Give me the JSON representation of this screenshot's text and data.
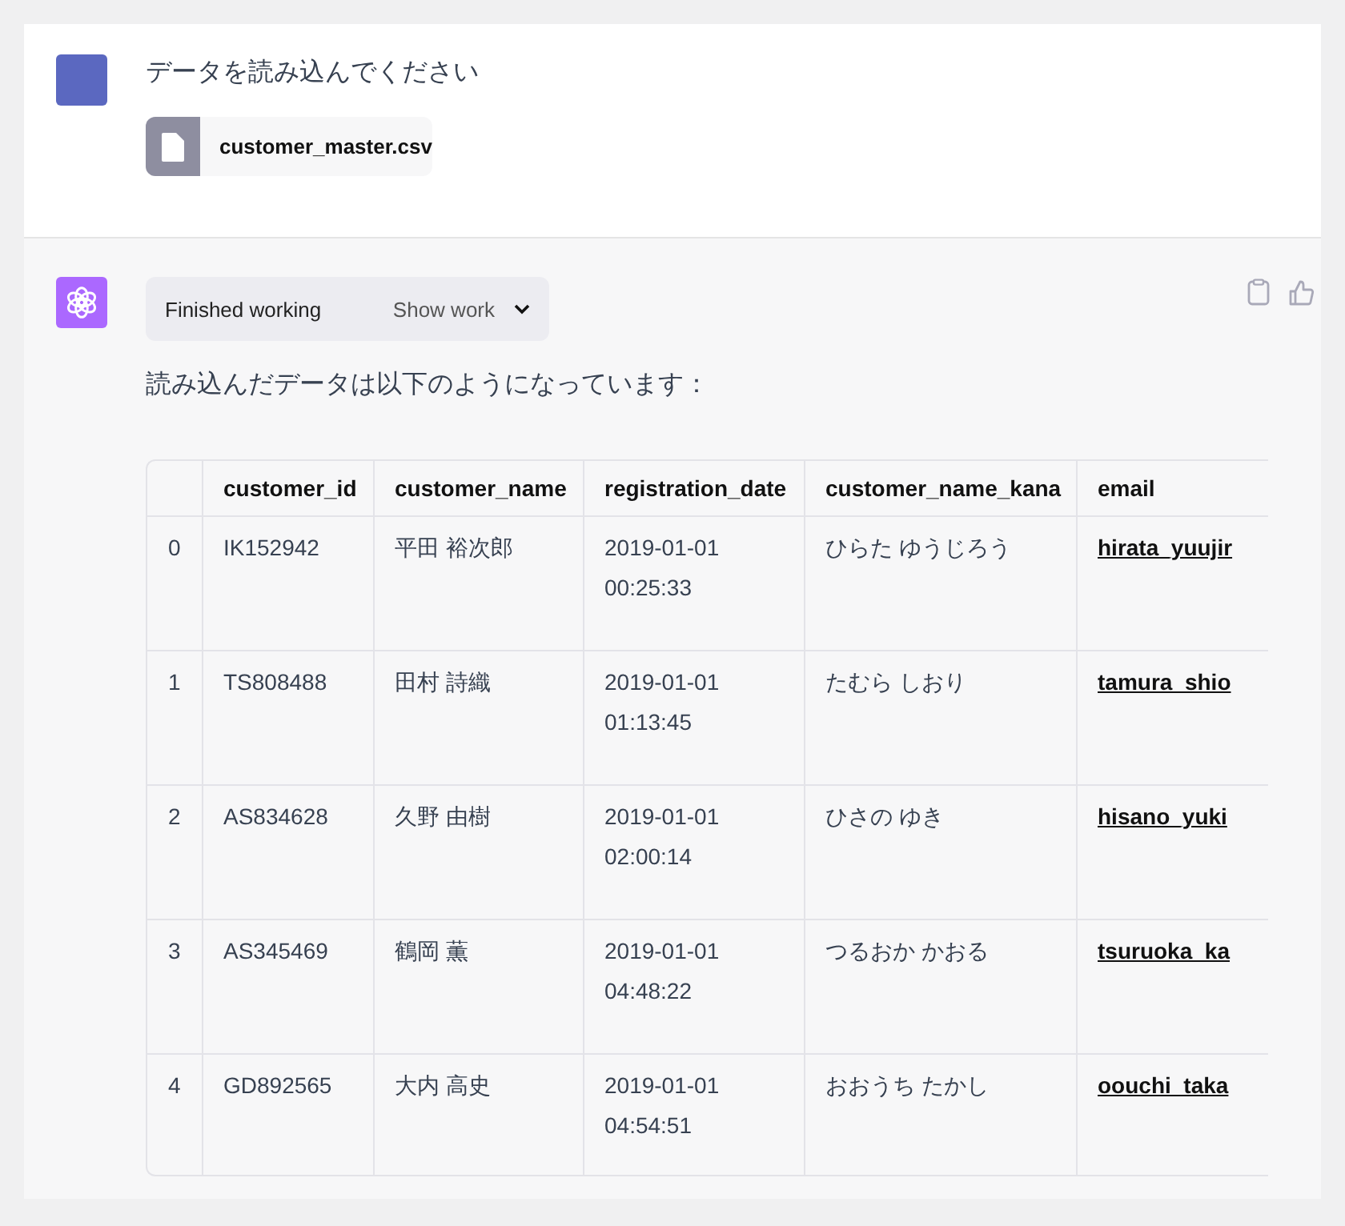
{
  "user_message": {
    "text": "データを読み込んでください",
    "attachment": {
      "filename": "customer_master.csv"
    }
  },
  "assistant_message": {
    "work_status": {
      "label": "Finished working",
      "toggle": "Show work",
      "expanded": false
    },
    "text": "読み込んだデータは以下のようになっています：",
    "table": {
      "columns": [
        "",
        "customer_id",
        "customer_name",
        "registration_date",
        "customer_name_kana",
        "email"
      ],
      "rows": [
        {
          "index": "0",
          "customer_id": "IK152942",
          "customer_name": "平田 裕次郎",
          "registration_date": [
            "2019-01-01",
            "00:25:33"
          ],
          "customer_name_kana": "ひらた ゆうじろう",
          "email": "hirata_yuujir"
        },
        {
          "index": "1",
          "customer_id": "TS808488",
          "customer_name": "田村 詩織",
          "registration_date": [
            "2019-01-01",
            "01:13:45"
          ],
          "customer_name_kana": "たむら しおり",
          "email": "tamura_shio"
        },
        {
          "index": "2",
          "customer_id": "AS834628",
          "customer_name": "久野 由樹",
          "registration_date": [
            "2019-01-01",
            "02:00:14"
          ],
          "customer_name_kana": "ひさの ゆき",
          "email": "hisano_yuki"
        },
        {
          "index": "3",
          "customer_id": "AS345469",
          "customer_name": "鶴岡 薫",
          "registration_date": [
            "2019-01-01",
            "04:48:22"
          ],
          "customer_name_kana": "つるおか かおる",
          "email": "tsuruoka_ka"
        },
        {
          "index": "4",
          "customer_id": "GD892565",
          "customer_name": "大内 高史",
          "registration_date": [
            "2019-01-01",
            "04:54:51"
          ],
          "customer_name_kana": "おおうち たかし",
          "email": "oouchi_taka"
        }
      ]
    }
  }
}
